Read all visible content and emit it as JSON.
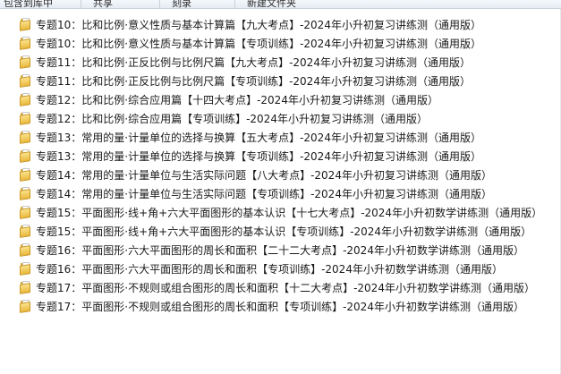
{
  "toolbar": {
    "items": [
      "包含到库中",
      "共享",
      "刻录",
      "新建文件夹"
    ]
  },
  "folders": [
    "专题10：比和比例·意义性质与基本计算篇【九大考点】-2024年小升初复习讲练测（通用版）",
    "专题10：比和比例·意义性质与基本计算篇【专项训练】-2024年小升初复习讲练测（通用版）",
    "专题11：比和比例·正反比例与比例尺篇【九大考点】-2024年小升初复习讲练测（通用版）",
    "专题11：比和比例·正反比例与比例尺篇【专项训练】-2024年小升初复习讲练测（通用版）",
    "专题12：比和比例·综合应用篇【十四大考点】-2024年小升初复习讲练测（通用版）",
    "专题12：比和比例·综合应用篇【专项训练】-2024年小升初复习讲练测（通用版）",
    "专题13：常用的量·计量单位的选择与换算【五大考点】-2024年小升初复习讲练测（通用版）",
    "专题13：常用的量·计量单位的选择与换算【专项训练】-2024年小升初复习讲练测（通用版）",
    "专题14：常用的量·计量单位与生活实际问题【八大考点】-2024年小升初复习讲练测（通用版）",
    "专题14：常用的量·计量单位与生活实际问题【专项训练】-2024年小升初复习讲练测（通用版）",
    "专题15：平面图形·线+角+六大平面图形的基本认识【十七大考点】-2024年小升初数学讲练测（通用版）",
    "专题15：平面图形·线+角+六大平面图形的基本认识【专项训练】-2024年小升初数学讲练测（通用版）",
    "专题16：平面图形·六大平面图形的周长和面积【二十二大考点】-2024年小升初数学讲练测（通用版）",
    "专题16：平面图形·六大平面图形的周长和面积【专项训练】-2024年小升初数学讲练测（通用版）",
    "专题17：平面图形·不规则或组合图形的周长和面积【十二大考点】-2024年小升初数学讲练测（通用版）",
    "专题17：平面图形·不规则或组合图形的周长和面积【专项训练】-2024年小升初数学讲练测（通用版）"
  ]
}
